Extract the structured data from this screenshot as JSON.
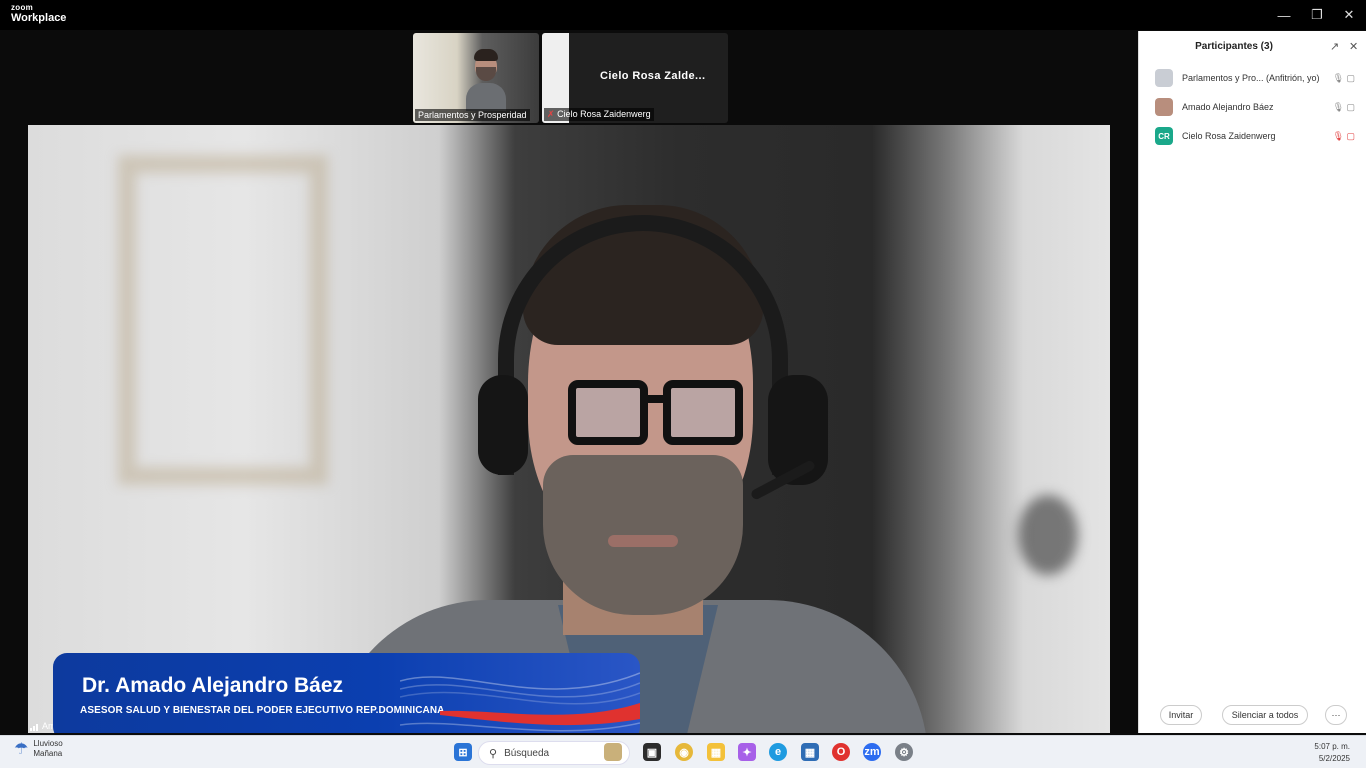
{
  "app": {
    "logo_line1": "zoom",
    "logo_line2": "Workplace",
    "window_controls": [
      "minimize-icon",
      "restore-icon",
      "close-icon"
    ]
  },
  "thumbnails": [
    {
      "label": "Parlamentos y Prosperidad",
      "muted": false
    },
    {
      "display_name": "Cielo  Rosa  Zalde...",
      "label": "Cielo Rosa Zaidenwerg",
      "muted": true
    }
  ],
  "main_video": {
    "speaker_short": "Am",
    "lower_third": {
      "name": "Dr. Amado Alejandro Báez",
      "title": "ASESOR SALUD Y BIENESTAR DEL PODER EJECUTIVO REP.DOMINICANA"
    }
  },
  "participants_panel": {
    "title": "Participantes (3)",
    "participants": [
      {
        "name": "Parlamentos y Pro... (Anfitrión, yo)",
        "avatar": "",
        "avatar_color": "#c9cdd4",
        "status": "🎙 ▢",
        "muted": false
      },
      {
        "name": "Amado Alejandro Báez",
        "avatar": "",
        "avatar_color": "#b88e7d",
        "status": "🎙 ▢",
        "muted": false
      },
      {
        "name": "Cielo Rosa Zaidenwerg",
        "avatar": "CR",
        "avatar_color": "#1aa88a",
        "status": "🎙 ▢",
        "muted": true
      }
    ],
    "invite_label": "Invitar",
    "mute_all_label": "Silenciar a todos",
    "more_label": "···"
  },
  "taskbar": {
    "weather_line1": "Lluvioso",
    "weather_line2": "Mañana",
    "search_placeholder": "Búsqueda",
    "time": "5:07 p. m.",
    "date": "5/2/2025"
  },
  "colors": {
    "lower_third_blue": "#0b3fb0",
    "accent_red": "#e0322f",
    "avatar_green": "#1aa88a"
  }
}
